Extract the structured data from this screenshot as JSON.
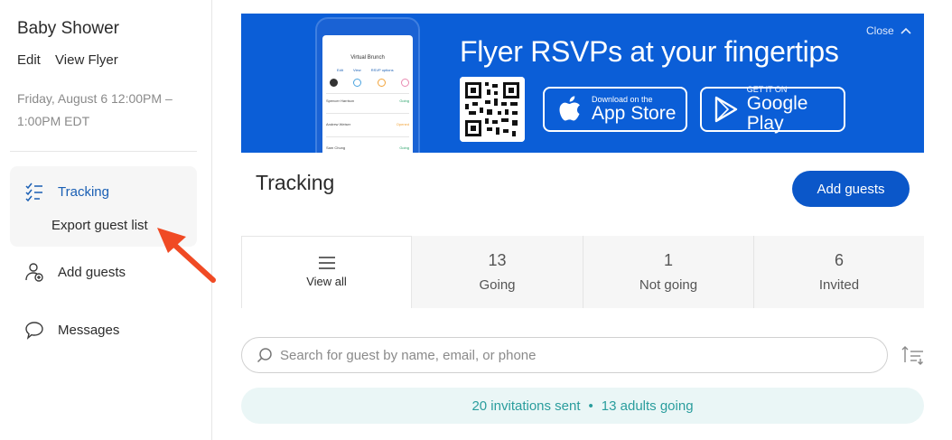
{
  "sidebar": {
    "event_title": "Baby Shower",
    "edit_label": "Edit",
    "view_flyer_label": "View Flyer",
    "event_time": "Friday, August 6 12:00PM – 1:00PM EDT",
    "nav": {
      "tracking": {
        "label": "Tracking",
        "icon": "checklist-icon"
      },
      "export": {
        "label": "Export guest list"
      },
      "add_guests": {
        "label": "Add guests",
        "icon": "add-user-icon"
      },
      "messages": {
        "label": "Messages",
        "icon": "chat-bubble-icon"
      }
    }
  },
  "banner": {
    "headline": "Flyer RSVPs at your fingertips",
    "close_label": "Close",
    "app_store": {
      "small": "Download on the",
      "big": "App Store"
    },
    "google_play": {
      "small": "GET IT ON",
      "big": "Google Play"
    },
    "phone": {
      "title": "Virtual Brunch",
      "tabs": [
        "Edit",
        "View",
        "RSVP options"
      ],
      "rows": [
        {
          "name": "Spencer Harrison",
          "status": "Going"
        },
        {
          "name": "Andrew Weiser",
          "status": "Opened"
        },
        {
          "name": "Sam Chung",
          "status": "Going"
        }
      ]
    },
    "colors": {
      "background": "#0b5ed7"
    }
  },
  "main": {
    "title": "Tracking",
    "add_guests_button": "Add guests",
    "tabs": [
      {
        "label": "View all",
        "icon": "menu-lines-icon"
      },
      {
        "count": "13",
        "label": "Going"
      },
      {
        "count": "1",
        "label": "Not going"
      },
      {
        "count": "6",
        "label": "Invited"
      }
    ],
    "search": {
      "placeholder": "Search for guest by name, email, or phone",
      "value": ""
    },
    "summary": {
      "sent": "20 invitations sent",
      "separator": "•",
      "going": "13 adults going"
    },
    "colors": {
      "accent": "#0b57c9",
      "summary_text": "#2a9d9d",
      "summary_bg": "#eaf6f6"
    }
  }
}
